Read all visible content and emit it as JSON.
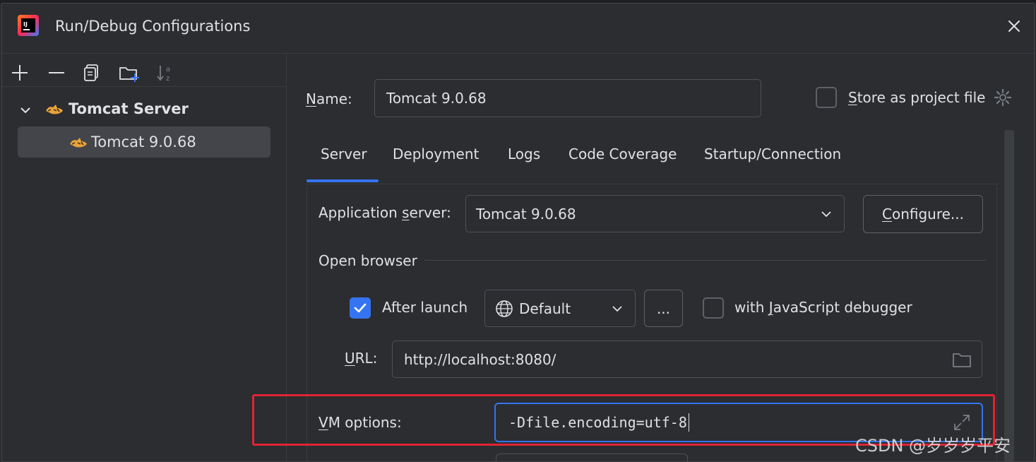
{
  "window": {
    "title": "Run/Debug Configurations",
    "app_icon": "intellij-logo-icon",
    "close_icon": "close-icon"
  },
  "toolbar": {
    "icons": [
      "add-icon",
      "remove-icon",
      "copy-icon",
      "new-folder-icon",
      "sort-alpha-icon"
    ]
  },
  "tree": {
    "group_label": "Tomcat Server",
    "item_label": "Tomcat 9.0.68",
    "group_icon": "tomcat-icon"
  },
  "form": {
    "name_label": "Name:",
    "name_value": "Tomcat 9.0.68",
    "store_label": "Store as project file",
    "store_checked": false
  },
  "tabs": [
    "Server",
    "Deployment",
    "Logs",
    "Code Coverage",
    "Startup/Connection"
  ],
  "active_tab": "Server",
  "server": {
    "app_server_label": "Application server:",
    "app_server_value": "Tomcat 9.0.68",
    "configure_label": "Configure...",
    "open_browser_label": "Open browser",
    "after_launch_label": "After launch",
    "after_launch_checked": true,
    "browser_value": "Default",
    "more_label": "...",
    "js_debugger_label": "with JavaScript debugger",
    "js_debugger_checked": false,
    "url_label": "URL:",
    "url_value": "http://localhost:8080/",
    "vm_label": "VM options:",
    "vm_value": "-Dfile.encoding=utf-8"
  },
  "watermark": "CSDN @岁岁岁平安",
  "colors": {
    "accent": "#3574f0",
    "highlight_box": "#e02433",
    "background": "#2b2d30"
  }
}
